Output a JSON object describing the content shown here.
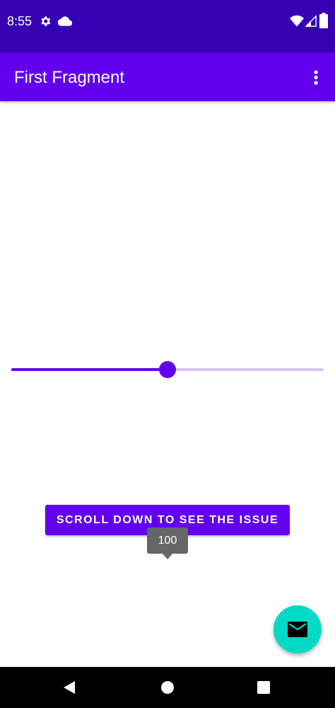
{
  "status_bar": {
    "time": "8:55",
    "icons": [
      "gear-icon",
      "cloud-icon",
      "wifi-icon",
      "signal-icon",
      "battery-icon"
    ],
    "background": "#3700B3"
  },
  "app_bar": {
    "title": "First Fragment",
    "menu_icon": "more-vert-icon",
    "background": "#6200EE"
  },
  "slider": {
    "value_fraction": 0.5,
    "active_color": "#6200EE",
    "inactive_color": "#D7C2F8"
  },
  "main_button": {
    "label": "SCROLL DOWN TO SEE THE ISSUE"
  },
  "tooltip": {
    "value": "100"
  },
  "fab": {
    "icon": "mail-icon",
    "color": "#03DAC5"
  },
  "nav_bar": {
    "icons": [
      "back-icon",
      "home-icon",
      "recents-icon"
    ]
  }
}
